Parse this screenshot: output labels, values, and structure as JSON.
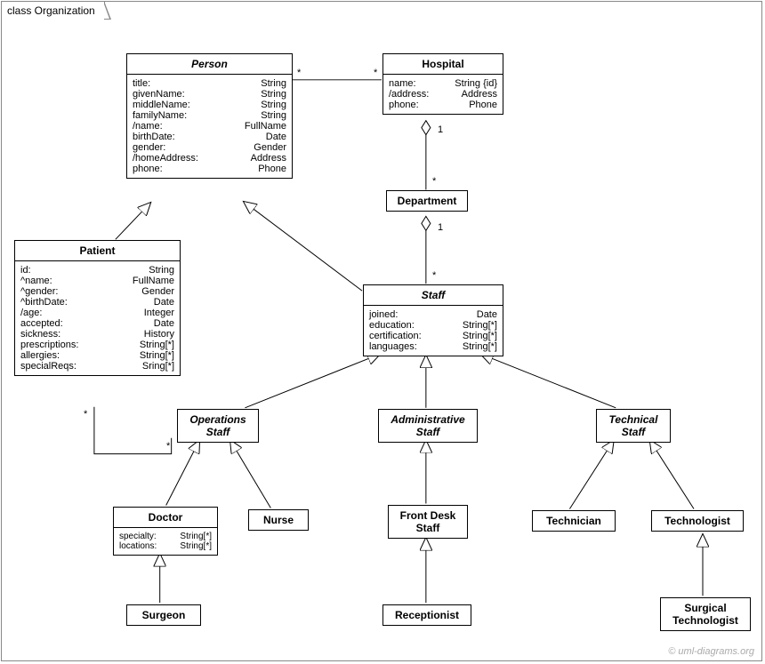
{
  "frame": {
    "label": "class Organization"
  },
  "copyright": "© uml-diagrams.org",
  "classes": {
    "person": {
      "name": "Person",
      "attrs": [
        [
          "title:",
          "String"
        ],
        [
          "givenName:",
          "String"
        ],
        [
          "middleName:",
          "String"
        ],
        [
          "familyName:",
          "String"
        ],
        [
          "/name:",
          "FullName"
        ],
        [
          "birthDate:",
          "Date"
        ],
        [
          "gender:",
          "Gender"
        ],
        [
          "/homeAddress:",
          "Address"
        ],
        [
          "phone:",
          "Phone"
        ]
      ]
    },
    "hospital": {
      "name": "Hospital",
      "attrs": [
        [
          "name:",
          "String {id}"
        ],
        [
          "/address:",
          "Address"
        ],
        [
          "phone:",
          "Phone"
        ]
      ]
    },
    "department": {
      "name": "Department"
    },
    "patient": {
      "name": "Patient",
      "attrs": [
        [
          "id:",
          "String"
        ],
        [
          "^name:",
          "FullName"
        ],
        [
          "^gender:",
          "Gender"
        ],
        [
          "^birthDate:",
          "Date"
        ],
        [
          "/age:",
          "Integer"
        ],
        [
          "accepted:",
          "Date"
        ],
        [
          "sickness:",
          "History"
        ],
        [
          "prescriptions:",
          "String[*]"
        ],
        [
          "allergies:",
          "String[*]"
        ],
        [
          "specialReqs:",
          "Sring[*]"
        ]
      ]
    },
    "staff": {
      "name": "Staff",
      "attrs": [
        [
          "joined:",
          "Date"
        ],
        [
          "education:",
          "String[*]"
        ],
        [
          "certification:",
          "String[*]"
        ],
        [
          "languages:",
          "String[*]"
        ]
      ]
    },
    "operationsStaff": {
      "name": "Operations\nStaff"
    },
    "administrativeStaff": {
      "name": "Administrative\nStaff"
    },
    "technicalStaff": {
      "name": "Technical\nStaff"
    },
    "doctor": {
      "name": "Doctor",
      "attrs": [
        [
          "specialty:",
          "String[*]"
        ],
        [
          "locations:",
          "String[*]"
        ]
      ]
    },
    "nurse": {
      "name": "Nurse"
    },
    "frontDeskStaff": {
      "name": "Front Desk\nStaff"
    },
    "technician": {
      "name": "Technician"
    },
    "technologist": {
      "name": "Technologist"
    },
    "surgeon": {
      "name": "Surgeon"
    },
    "receptionist": {
      "name": "Receptionist"
    },
    "surgicalTechnologist": {
      "name": "Surgical\nTechnologist"
    }
  },
  "multiplicities": {
    "personHospL": "*",
    "personHospR": "*",
    "hospDeptTop": "1",
    "hospDeptBot": "*",
    "deptStaffTop": "1",
    "deptStaffBot": "*",
    "patientOpsL": "*",
    "patientOpsR": "*"
  }
}
